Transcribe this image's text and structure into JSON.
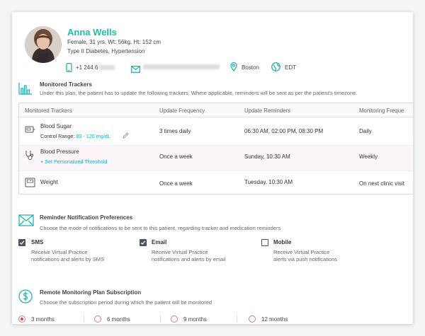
{
  "profile": {
    "name": "Anna Wells",
    "details": "Female, 31 yrs, Wt: 56kg, Ht: 152 cm",
    "conditions": "Type II Diabetes, Hypertension",
    "phone": "+1 244 6",
    "email": "",
    "location": "Boston",
    "timezone": "EDT"
  },
  "trackers": {
    "title": "Monitored Trackers",
    "subtitle": "Under this plan, the patient has to update the following trackers. Where applicable, reminders will be sent as per the patient's timezone.",
    "columns": [
      "Monitored Trackers",
      "Update Frequency",
      "Update Reminders",
      "Monitoring Freque"
    ],
    "rows": [
      {
        "name": "Blood Sugar",
        "sub_label": "Control Range:",
        "sub_value": "80 - 120 mg/dL",
        "frequency": "3 times daily",
        "reminders": "06:30 AM, 02:00 PM, 08:30 PM",
        "monitoring": "Daily"
      },
      {
        "name": "Blood Pressure",
        "sub_link": "+ Set Personalized Threshold",
        "frequency": "Once a week",
        "reminders": "Sunday, 10:30 AM",
        "monitoring": "Weekly"
      },
      {
        "name": "Weight",
        "frequency": "Once a week",
        "reminders": "Tuesday, 10:30 AM",
        "monitoring": "On next clinic visit"
      }
    ]
  },
  "notifications": {
    "title": "Reminder Notification Preferences",
    "subtitle": "Choose the mode of notifications to be sent to this patient, regarding tracker and medication reminders",
    "options": [
      {
        "label": "SMS",
        "checked": true,
        "desc1": "Receive Virtual Practice",
        "desc2": "notifications and alerts by SMS"
      },
      {
        "label": "Email",
        "checked": true,
        "desc1": "Receive Virtual Practice",
        "desc2": "notifications and alerts by email"
      },
      {
        "label": "Mobile",
        "checked": false,
        "desc1": "Receive Virtual Practice",
        "desc2": "alerts via push notifications"
      }
    ]
  },
  "subscription": {
    "title": "Remote Monitoring Plan Subscription",
    "subtitle": "Choose the subscription period during which the patient will be monitored",
    "options": [
      {
        "label": "3 months",
        "selected": true
      },
      {
        "label": "6 months",
        "selected": false
      },
      {
        "label": "9 months",
        "selected": false
      },
      {
        "label": "12 months",
        "selected": false
      }
    ]
  },
  "colors": {
    "accent": "#1fbfa7",
    "link": "#1fa7c7",
    "radio_selected": "#e04848"
  }
}
